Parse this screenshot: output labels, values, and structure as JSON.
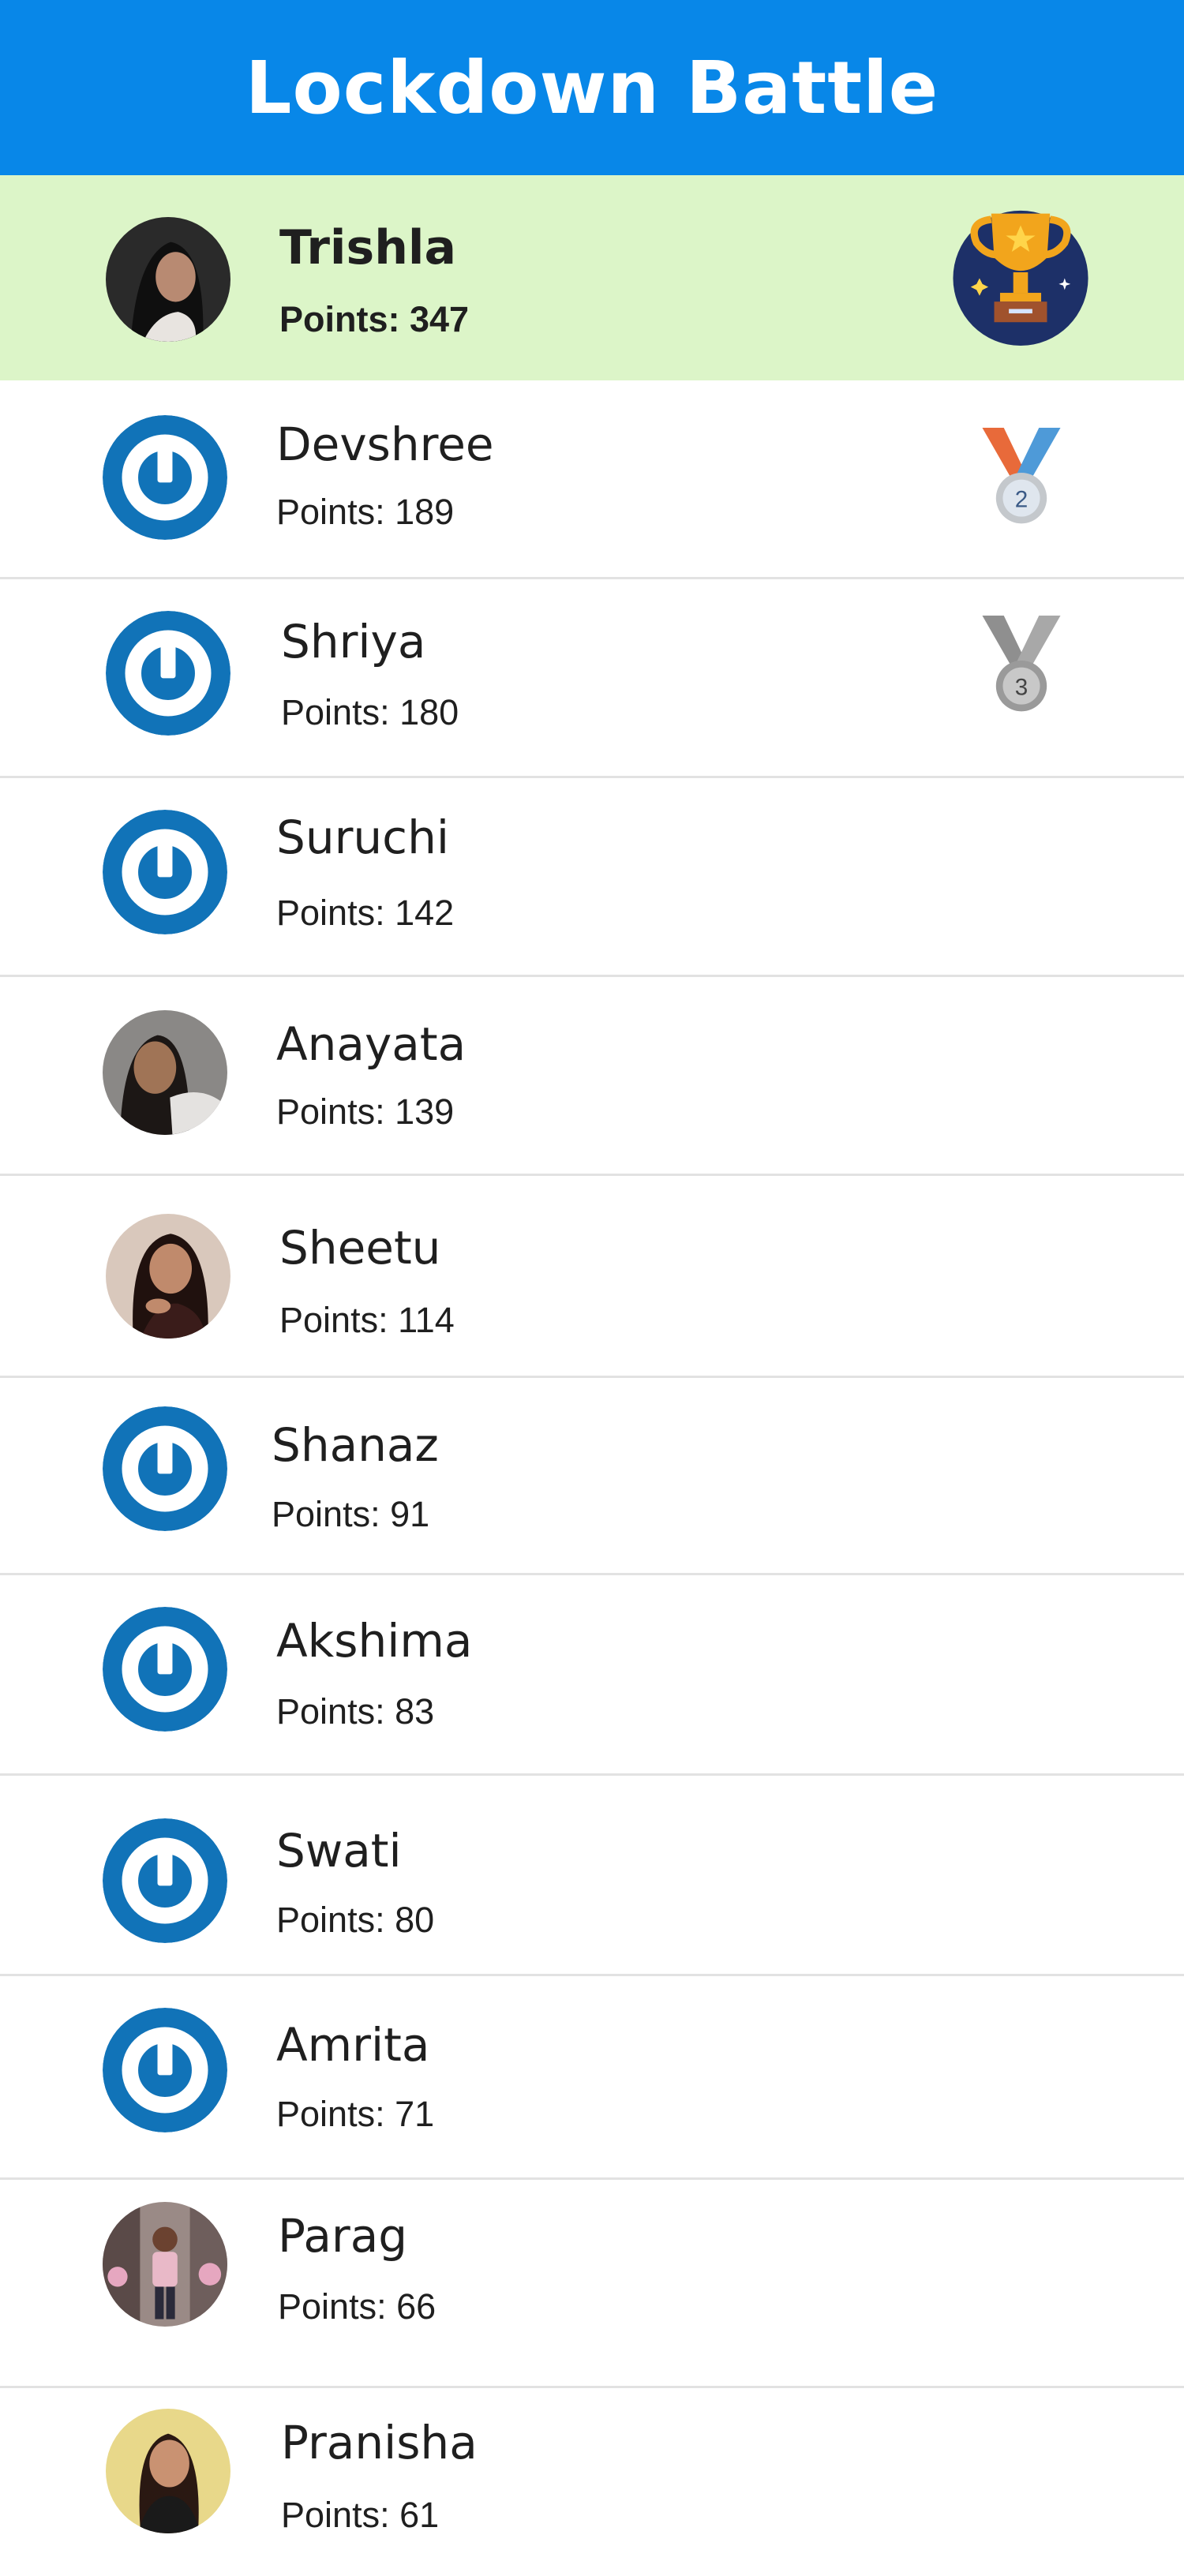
{
  "header": {
    "title": "Lockdown Battle"
  },
  "colors": {
    "header_bg": "#0887e8",
    "leader_bg": "#dcf5c8",
    "default_avatar": "#1173b8",
    "divider": "#e2e2e2"
  },
  "leaderboard": [
    {
      "name": "Trishla",
      "points_label": "Points: 347",
      "avatar": "photo",
      "badge": "trophy-icon"
    },
    {
      "name": "Devshree",
      "points_label": "Points: 189",
      "avatar": "default",
      "badge": "medal-2",
      "medal_number": "2"
    },
    {
      "name": "Shriya",
      "points_label": "Points: 180",
      "avatar": "default",
      "badge": "medal-3",
      "medal_number": "3"
    },
    {
      "name": "Suruchi",
      "points_label": "Points: 142",
      "avatar": "default"
    },
    {
      "name": "Anayata",
      "points_label": "Points: 139",
      "avatar": "photo"
    },
    {
      "name": "Sheetu",
      "points_label": "Points: 114",
      "avatar": "photo"
    },
    {
      "name": "Shanaz",
      "points_label": "Points: 91",
      "avatar": "default"
    },
    {
      "name": "Akshima",
      "points_label": "Points: 83",
      "avatar": "default"
    },
    {
      "name": "Swati",
      "points_label": "Points: 80",
      "avatar": "default"
    },
    {
      "name": "Amrita",
      "points_label": "Points: 71",
      "avatar": "default"
    },
    {
      "name": "Parag",
      "points_label": "Points: 66",
      "avatar": "photo"
    },
    {
      "name": "Pranisha",
      "points_label": "Points: 61",
      "avatar": "photo"
    }
  ]
}
